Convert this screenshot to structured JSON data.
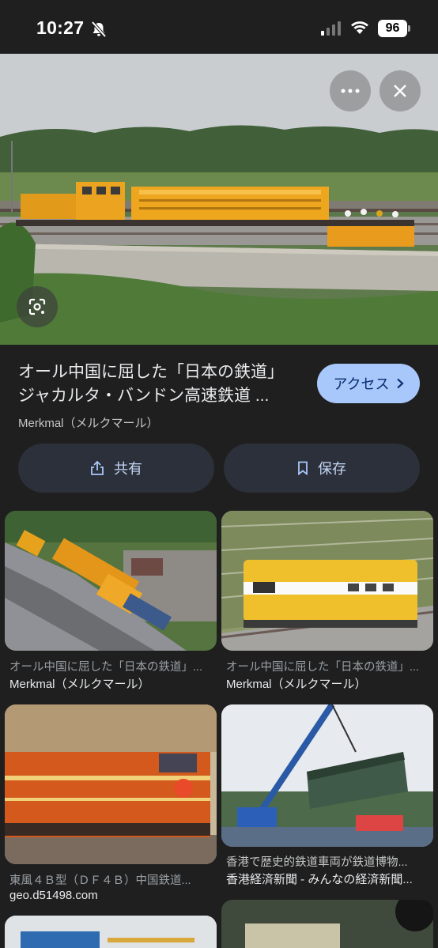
{
  "status_bar": {
    "time": "10:27",
    "battery": "96"
  },
  "result": {
    "title_line1": "オール中国に屈した「日本の鉄道」",
    "title_line2": "ジャカルタ・バンドン高速鉄道 ...",
    "source": "Merkmal（メルクマール）",
    "access_label": "アクセス",
    "share_label": "共有",
    "save_label": "保存"
  },
  "related": [
    {
      "caption": "オール中国に屈した「日本の鉄道」...",
      "source": "Merkmal（メルクマール）"
    },
    {
      "caption": "オール中国に屈した「日本の鉄道」...",
      "source": "Merkmal（メルクマール）"
    },
    {
      "caption": "東風４Ｂ型（ＤＦ４Ｂ）中国鉄道...",
      "source": "geo.d51498.com"
    },
    {
      "caption": "香港で歴史的鉄道車両が鉄道博物...",
      "source": "香港経済新聞 - みんなの経済新聞..."
    }
  ],
  "colors": {
    "background": "#1f1f1f",
    "accent": "#a8c7fa",
    "pill": "#2c303a"
  }
}
